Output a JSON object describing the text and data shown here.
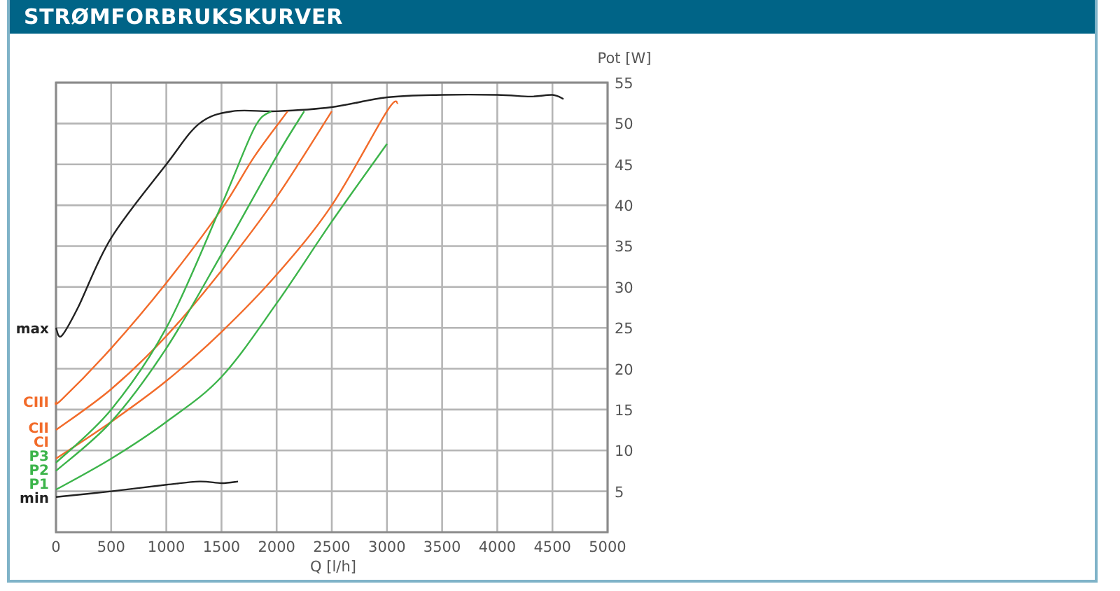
{
  "header": {
    "title": "STRØMFORBRUKSKURVER"
  },
  "chart": {
    "chart_data": {
      "type": "line",
      "grid": true,
      "xlabel": "Q [l/h]",
      "ylabel": "Pot [W]",
      "xlim": [
        0,
        5000
      ],
      "ylim": [
        0,
        55
      ],
      "xticks": [
        0,
        500,
        1000,
        1500,
        2000,
        2500,
        3000,
        3500,
        4000,
        4500,
        5000
      ],
      "yticks": [
        5,
        10,
        15,
        20,
        25,
        30,
        35,
        40,
        45,
        50,
        55
      ],
      "series": [
        {
          "name": "max",
          "color": "#222222",
          "x": [
            0,
            50,
            200,
            500,
            1000,
            1300,
            1600,
            2000,
            2500,
            3000,
            3500,
            4000,
            4300,
            4500,
            4600
          ],
          "values": [
            25,
            24,
            27.5,
            36,
            45,
            50,
            51.5,
            51.5,
            52,
            53.2,
            53.5,
            53.5,
            53.3,
            53.5,
            53
          ]
        },
        {
          "name": "CIII",
          "color": "#f26b2a",
          "x": [
            0,
            50,
            500,
            1000,
            1500,
            1800,
            2100
          ],
          "values": [
            16,
            16.2,
            22.5,
            30.5,
            39.5,
            46,
            51.5
          ]
        },
        {
          "name": "CII",
          "color": "#f26b2a",
          "x": [
            0,
            500,
            1000,
            1500,
            2000,
            2500
          ],
          "values": [
            12.5,
            17.5,
            24,
            32,
            41,
            51.5
          ]
        },
        {
          "name": "CI",
          "color": "#f26b2a",
          "x": [
            0,
            500,
            1000,
            1500,
            2000,
            2500,
            3000,
            3100
          ],
          "values": [
            9,
            13.5,
            18.5,
            24.5,
            31.5,
            40,
            51.5,
            52.5
          ]
        },
        {
          "name": "P3",
          "color": "#3cb44a",
          "x": [
            0,
            500,
            1000,
            1500,
            1800,
            1950
          ],
          "values": [
            8.5,
            15,
            25,
            40,
            49.5,
            51.5
          ]
        },
        {
          "name": "P2",
          "color": "#3cb44a",
          "x": [
            0,
            500,
            1000,
            1500,
            2000,
            2250
          ],
          "values": [
            7.5,
            13.5,
            22.5,
            34,
            46,
            51.5
          ]
        },
        {
          "name": "P1",
          "color": "#3cb44a",
          "x": [
            0,
            500,
            1000,
            1500,
            2000,
            2500,
            3000
          ],
          "values": [
            5.2,
            9,
            13.5,
            19,
            28,
            38,
            47.5
          ]
        },
        {
          "name": "min",
          "color": "#222222",
          "x": [
            0,
            500,
            1000,
            1300,
            1500,
            1650
          ],
          "values": [
            4.3,
            5,
            5.8,
            6.2,
            6,
            6.2
          ]
        }
      ]
    }
  }
}
